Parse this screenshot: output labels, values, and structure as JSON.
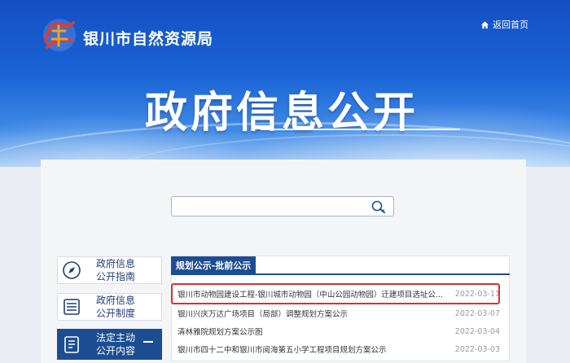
{
  "header": {
    "site_name": "银川市自然资源局",
    "home_link": "返回首页",
    "page_title": "政府信息公开",
    "logo_icon": "gov-open-logo",
    "home_icon": "home-icon"
  },
  "search": {
    "placeholder": ""
  },
  "sidebar": {
    "items": [
      {
        "label_line1": "政府信息",
        "label_line2": "公开指南",
        "icon": "compass-icon",
        "active": false
      },
      {
        "label_line1": "政府信息",
        "label_line2": "公开制度",
        "icon": "list-icon",
        "active": false
      },
      {
        "label_line1": "法定主动",
        "label_line2": "公开内容",
        "icon": "document-icon",
        "active": true
      }
    ]
  },
  "list": {
    "tab_label": "规划公示-批前公示",
    "rows": [
      {
        "title": "银川市动物园建设工程-银川城市动物园（中山公园动物园）迁建项目选址公...",
        "date": "2022-03-11",
        "highlighted": true
      },
      {
        "title": "银川兴庆万达广场项目（局部）调整规划方案公示",
        "date": "2022-03-07",
        "highlighted": false
      },
      {
        "title": "清林雅院规划方案公示图",
        "date": "2022-03-04",
        "highlighted": false
      },
      {
        "title": "银川市四十二中和银川市阅海第五小学工程项目规划方案公示",
        "date": "2022-03-03",
        "highlighted": false
      }
    ]
  },
  "colors": {
    "brand_blue": "#1c4d93",
    "banner_blue": "#1a63d6",
    "highlight_red": "#d93030"
  }
}
